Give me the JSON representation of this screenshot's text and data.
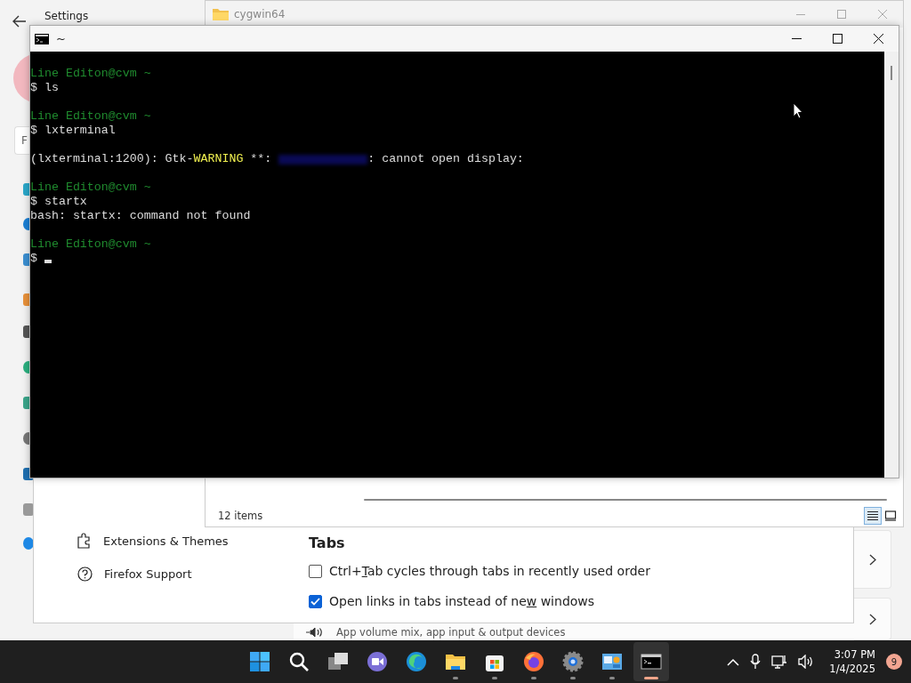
{
  "settings_window": {
    "title": "Settings",
    "search": {
      "placeholder": "F"
    },
    "cards": [
      {
        "kind": "plain"
      },
      {
        "kind": "volume",
        "text": "App volume mix, app input & output devices"
      }
    ]
  },
  "explorer_window": {
    "title": "cygwin64",
    "status": "12 items",
    "views": [
      {
        "kind": "details",
        "selected": true
      },
      {
        "kind": "tiles",
        "selected": false
      }
    ]
  },
  "firefox_window": {
    "menu": [
      {
        "kind": "extensions",
        "label": "Extensions & Themes"
      },
      {
        "kind": "support",
        "label": "Firefox Support"
      }
    ],
    "section": "Tabs",
    "options": [
      {
        "before": "Ctrl+",
        "key": "T",
        "after": "ab cycles through tabs in recently used order",
        "checked": false
      },
      {
        "before": "Open links in tabs instead of ne",
        "key": "w",
        "after": " windows",
        "checked": true
      }
    ]
  },
  "terminal_window": {
    "title": "~",
    "lines": [
      {
        "kind": "prompt",
        "text": "Line Editon@cvm ~"
      },
      {
        "kind": "command",
        "text": "$ ls"
      },
      {
        "kind": "blank"
      },
      {
        "kind": "prompt",
        "text": "Line Editon@cvm ~"
      },
      {
        "kind": "command",
        "text": "$ lxterminal"
      },
      {
        "kind": "blank"
      },
      {
        "kind": "warning",
        "prefix": "(lxterminal:1200): Gtk-",
        "level": "WARNING",
        "marks": " **: ",
        "message": ": cannot open display:"
      },
      {
        "kind": "blank"
      },
      {
        "kind": "prompt",
        "text": "Line Editon@cvm ~"
      },
      {
        "kind": "command",
        "text": "$ startx"
      },
      {
        "kind": "output",
        "text": "bash: startx: command not found"
      },
      {
        "kind": "blank"
      },
      {
        "kind": "prompt",
        "text": "Line Editon@cvm ~"
      },
      {
        "kind": "command",
        "text": "$",
        "cursor": true
      }
    ]
  },
  "taskbar": {
    "apps": [
      {
        "kind": "start",
        "running": false,
        "selected": false
      },
      {
        "kind": "search",
        "running": false,
        "selected": false
      },
      {
        "kind": "taskview",
        "running": false,
        "selected": false
      },
      {
        "kind": "meet",
        "running": false,
        "selected": false
      },
      {
        "kind": "edge",
        "running": false,
        "selected": false
      },
      {
        "kind": "files",
        "running": true,
        "selected": false
      },
      {
        "kind": "store",
        "running": true,
        "selected": false
      },
      {
        "kind": "firefox",
        "running": true,
        "selected": false
      },
      {
        "kind": "settings",
        "running": true,
        "selected": false
      },
      {
        "kind": "control",
        "running": true,
        "selected": false
      },
      {
        "kind": "terminal",
        "running": true,
        "selected": true
      }
    ],
    "tray": [
      {
        "kind": "chevron"
      },
      {
        "kind": "mic"
      },
      {
        "kind": "network"
      },
      {
        "kind": "volume"
      }
    ],
    "time": "3:07 PM",
    "date": "1/4/2025",
    "badge": "9"
  }
}
